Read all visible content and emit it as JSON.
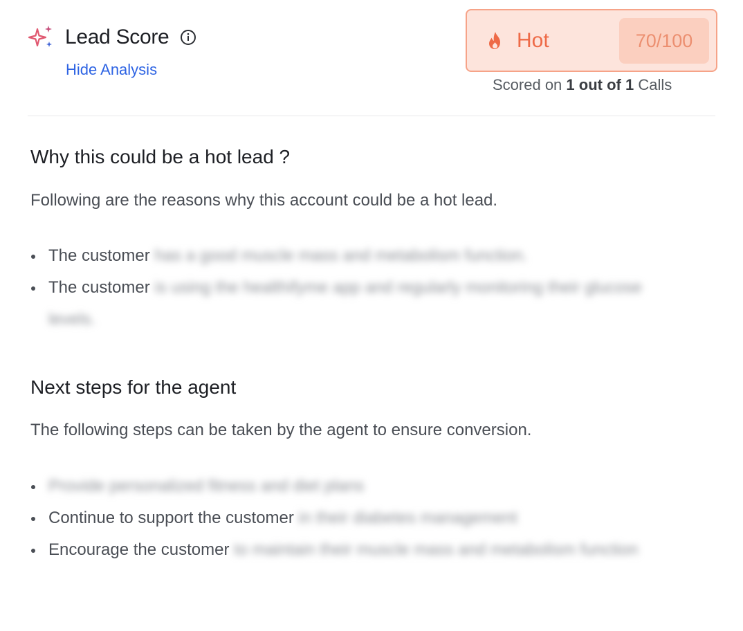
{
  "header": {
    "title": "Lead Score",
    "hide_link": "Hide Analysis",
    "score": {
      "label": "Hot",
      "value": "70/100",
      "scored_prefix": "Scored on",
      "scored_count": "1 out of 1",
      "scored_suffix": "Calls"
    },
    "icons": {
      "sparkle": "sparkle-icon",
      "info": "info-icon",
      "flame": "flame-icon"
    },
    "colors": {
      "accent": "#ee6a47",
      "link": "#2d63e3",
      "score_bg": "#fde4dc",
      "score_border": "#f6a388"
    }
  },
  "sections": [
    {
      "title": "Why this could be a hot lead ?",
      "description": "Following are the reasons why this account could be a hot lead.",
      "items": [
        {
          "visible": "The customer",
          "blurred": "has a good muscle mass and metabolism function."
        },
        {
          "visible": "The customer",
          "blurred": "is using the healthifyme app and regularly monitoring their glucose levels."
        }
      ]
    },
    {
      "title": "Next steps for the agent",
      "description": "The following steps can be taken by the agent to ensure conversion.",
      "items": [
        {
          "visible": "",
          "blurred": "Provide personalized fitness and diet plans"
        },
        {
          "visible": "Continue to support the customer",
          "blurred": "in their diabetes management"
        },
        {
          "visible": "Encourage the customer",
          "blurred": "to maintain their muscle mass and metabolism function"
        }
      ]
    }
  ]
}
